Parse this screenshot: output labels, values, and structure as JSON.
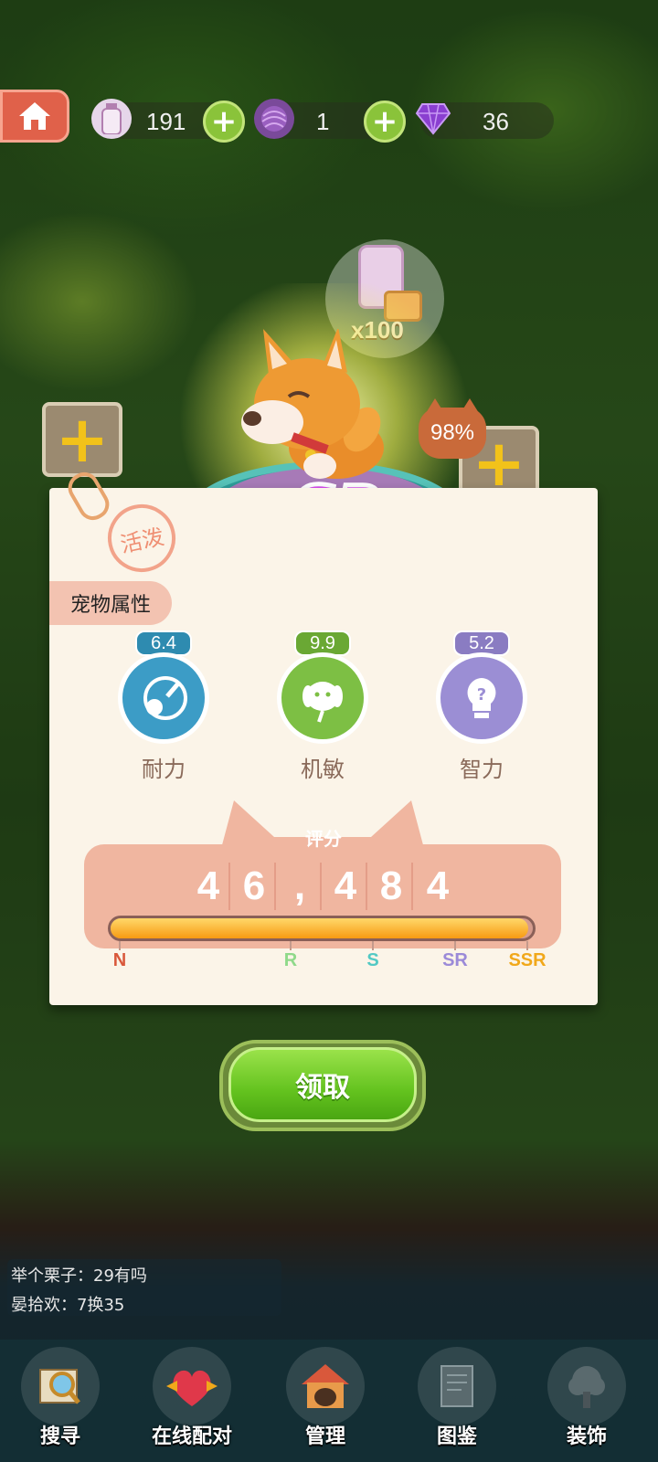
{
  "resources": [
    {
      "icon": "milk-bottle-icon",
      "value": "191"
    },
    {
      "icon": "yarn-ball-icon",
      "value": "1"
    },
    {
      "icon": "purple-gem-icon",
      "value": "36"
    }
  ],
  "reward": {
    "quantity": "x100"
  },
  "pet": {
    "rarity": "SR",
    "trait": "活泼",
    "chance": "98%"
  },
  "attributes": {
    "header": "宠物属性",
    "items": [
      {
        "label": "耐力",
        "value": "6.4",
        "color": "#2e8bb0"
      },
      {
        "label": "机敏",
        "value": "9.9",
        "color": "#6aa834"
      },
      {
        "label": "智力",
        "value": "5.2",
        "color": "#8a7cc2"
      }
    ]
  },
  "score": {
    "title": "评分",
    "digits": [
      "4",
      "6",
      ",",
      "4",
      "8",
      "4"
    ],
    "progress": 0.99,
    "ranks": [
      {
        "label": "N",
        "color": "#d9583b"
      },
      {
        "label": "R",
        "color": "#8fd98a"
      },
      {
        "label": "S",
        "color": "#52c9c4"
      },
      {
        "label": "SR",
        "color": "#9b8ad8"
      },
      {
        "label": "SSR",
        "color": "#f1a81a"
      }
    ]
  },
  "claim_label": "领取",
  "chat": [
    "举个栗子：29有吗",
    "晏拾欢：7换35"
  ],
  "nav": [
    {
      "label": "搜寻",
      "icon": "magnifier-map-icon"
    },
    {
      "label": "在线配对",
      "icon": "heart-candy-icon"
    },
    {
      "label": "管理",
      "icon": "doghouse-icon"
    },
    {
      "label": "图鉴",
      "icon": "book-icon"
    },
    {
      "label": "装饰",
      "icon": "tree-icon"
    }
  ]
}
